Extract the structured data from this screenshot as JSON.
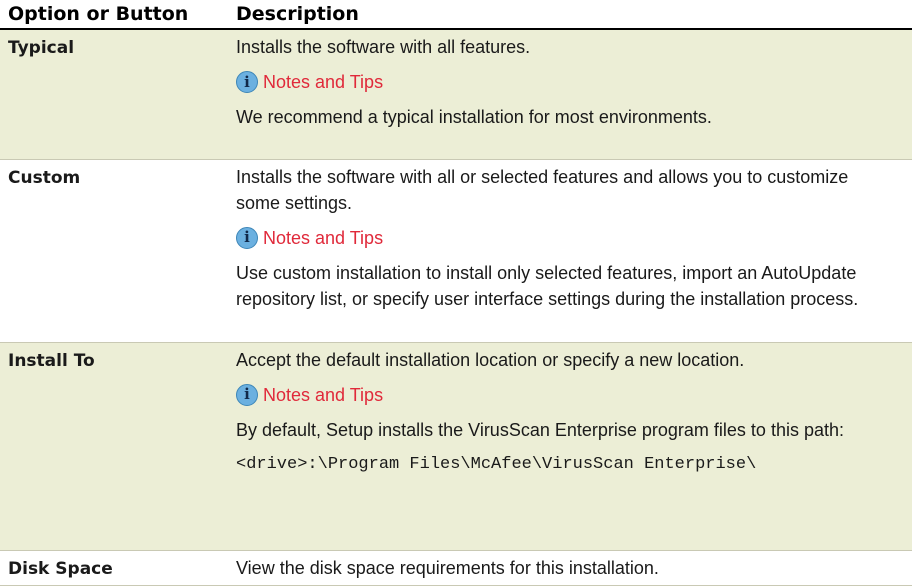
{
  "table": {
    "headers": {
      "option": "Option or Button",
      "description": "Description"
    },
    "rows": [
      {
        "option": "Typical",
        "description": "Installs the software with all features.",
        "note_label": "Notes and Tips",
        "note_text": "We recommend a typical installation for most environments."
      },
      {
        "option": "Custom",
        "description": "Installs the software with all or selected features and allows you to customize some settings.",
        "note_label": "Notes and Tips",
        "note_text": "Use custom installation to install only selected features, import an AutoUpdate repository list, or specify user interface settings during the installation process."
      },
      {
        "option": "Install To",
        "description": "Accept the default installation location or specify a new location.",
        "note_label": "Notes and Tips",
        "note_text": "By default, Setup installs the VirusScan Enterprise program files to this path:",
        "path": "<drive>:\\Program Files\\McAfee\\VirusScan Enterprise\\"
      },
      {
        "option": "Disk Space",
        "description": "View the disk space requirements for this installation."
      }
    ]
  },
  "icons": {
    "note": "info-icon"
  },
  "colors": {
    "shaded_row": "#eceed6",
    "note_label": "#e0293a",
    "info_icon": "#6bb0e0"
  }
}
